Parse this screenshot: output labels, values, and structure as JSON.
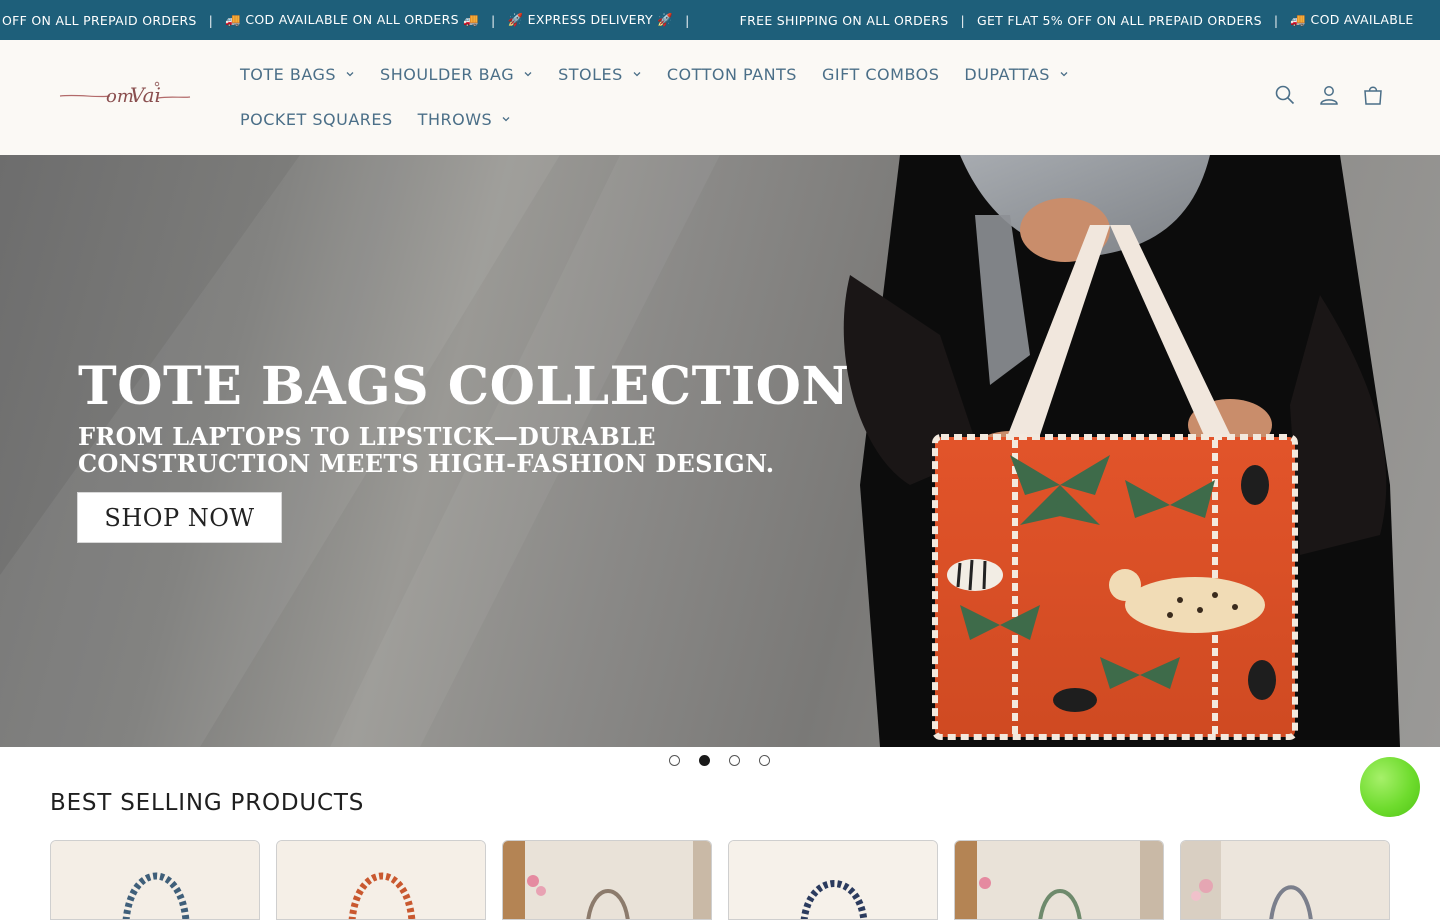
{
  "announcement": {
    "items": [
      "OFF ON ALL PREPAID ORDERS",
      "🚚 COD AVAILABLE ON ALL ORDERS 🚚",
      "🚀 EXPRESS DELIVERY 🚀",
      "FREE SHIPPING ON ALL ORDERS",
      "GET FLAT 5% OFF ON ALL PREPAID ORDERS",
      "🚚 COD AVAILABLE"
    ],
    "separator": "|"
  },
  "header": {
    "logo_text": "omVai",
    "nav": [
      {
        "label": "TOTE BAGS",
        "has_dropdown": true
      },
      {
        "label": "SHOULDER BAG",
        "has_dropdown": true
      },
      {
        "label": "STOLES",
        "has_dropdown": true
      },
      {
        "label": "COTTON PANTS",
        "has_dropdown": false
      },
      {
        "label": "GIFT COMBOS",
        "has_dropdown": false
      },
      {
        "label": "DUPATTAS",
        "has_dropdown": true
      },
      {
        "label": "POCKET SQUARES",
        "has_dropdown": false
      },
      {
        "label": "THROWS",
        "has_dropdown": true
      }
    ],
    "icons": [
      "search-icon",
      "account-icon",
      "cart-icon"
    ]
  },
  "hero": {
    "title": "TOTE BAGS COLLECTION",
    "subtitle_line1": "FROM LAPTOPS TO LIPSTICK—DURABLE",
    "subtitle_line2": "CONSTRUCTION MEETS HIGH-FASHION DESIGN.",
    "cta_label": "SHOP NOW",
    "slides_count": 4,
    "active_slide": 2
  },
  "best_sellers": {
    "title": "BEST SELLING PRODUCTS",
    "products": [
      {
        "name": "product-1"
      },
      {
        "name": "product-2"
      },
      {
        "name": "product-3"
      },
      {
        "name": "product-4"
      },
      {
        "name": "product-5"
      },
      {
        "name": "product-6"
      }
    ]
  },
  "colors": {
    "announcement_bg": "#1e5f7a",
    "nav_text": "#4b6f88",
    "header_bg": "#fbf9f5",
    "chat_button": "#6fdc2e"
  }
}
